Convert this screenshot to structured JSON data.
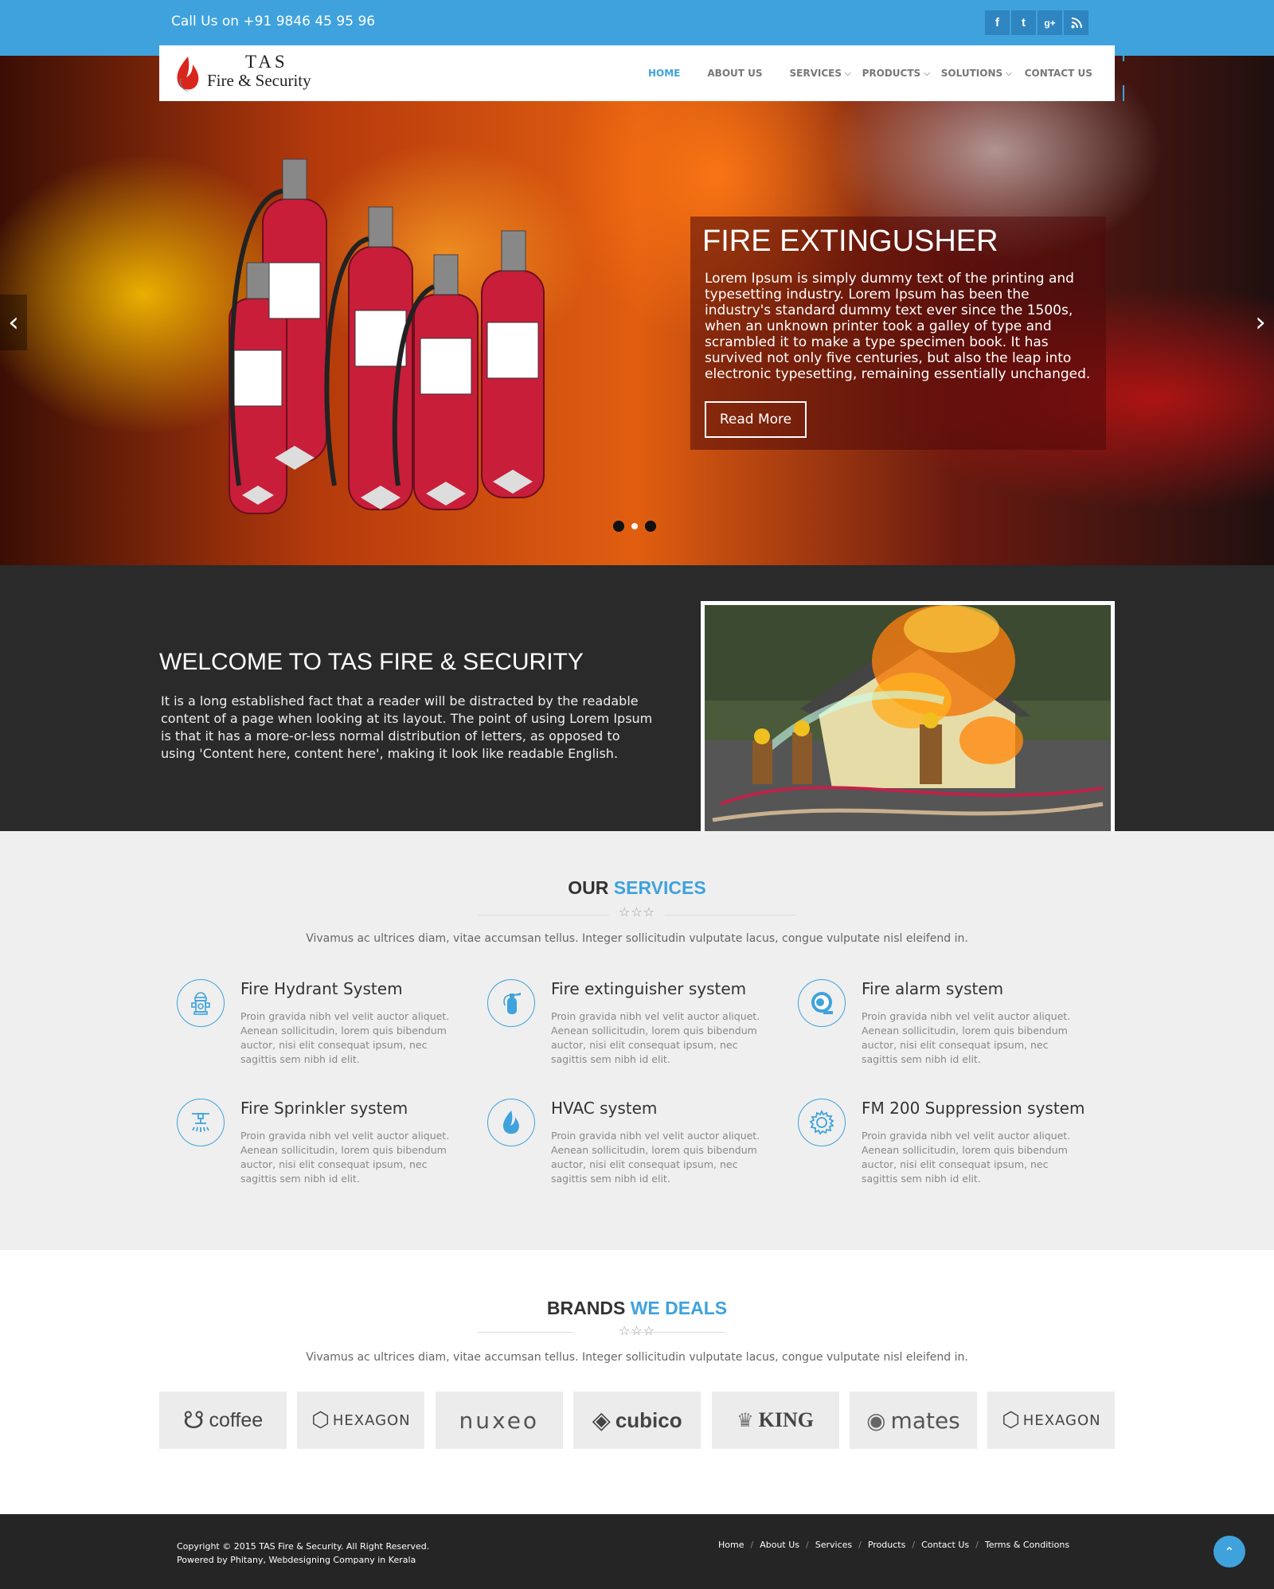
{
  "topbar": {
    "phone": "Call Us on +91 9846 45 95 96",
    "social": [
      {
        "icon": "facebook-icon",
        "glyph": "f"
      },
      {
        "icon": "twitter-icon",
        "glyph": "t"
      },
      {
        "icon": "google-plus-icon",
        "glyph": "g+"
      },
      {
        "icon": "rss-icon",
        "glyph": "rss"
      }
    ]
  },
  "logo": {
    "line1": "TAS",
    "line2": "Fire & Security"
  },
  "nav": {
    "items": [
      {
        "label": "HOME",
        "active": true
      },
      {
        "label": "ABOUT US"
      },
      {
        "label": "SERVICES",
        "dropdown": true
      },
      {
        "label": "PRODUCTS",
        "dropdown": true
      },
      {
        "label": "SOLUTIONS",
        "dropdown": true
      },
      {
        "label": "CONTACT US"
      }
    ]
  },
  "hero": {
    "title": "FIRE EXTINGUSHER",
    "text": "Lorem Ipsum is simply dummy text of the printing and typesetting industry. Lorem Ipsum has been the industry's standard dummy text ever since the 1500s, when an unknown printer took a galley of type and scrambled it to make a type specimen book. It has survived not only five centuries, but also the leap into electronic typesetting, remaining essentially unchanged.",
    "button": "Read More",
    "prev": "‹",
    "next": "›"
  },
  "welcome": {
    "title": "WELCOME TO TAS FIRE & SECURITY",
    "text": "It is a long established fact that a reader will be distracted by the readable content of a page when looking at its layout. The point of using Lorem Ipsum is that it has a more-or-less normal distribution of letters, as opposed to using 'Content here, content here', making it look like readable English."
  },
  "services": {
    "title_a": "OUR",
    "title_b": "SERVICES",
    "stars": "☆☆☆",
    "subtitle": "Vivamus ac ultrices diam, vitae accumsan tellus. Integer sollicitudin vulputate lacus, congue vulputate nisl eleifend in.",
    "items": [
      {
        "title": "Fire Hydrant System",
        "icon": "fire-hydrant-icon",
        "text": "Proin gravida nibh vel velit auctor aliquet. Aenean sollicitudin, lorem quis bibendum auctor, nisi elit consequat ipsum, nec sagittis sem nibh id elit."
      },
      {
        "title": "Fire extinguisher system",
        "icon": "fire-extinguisher-icon",
        "text": "Proin gravida nibh vel velit auctor aliquet. Aenean sollicitudin, lorem quis bibendum auctor, nisi elit consequat ipsum, nec sagittis sem nibh id elit."
      },
      {
        "title": "Fire alarm system",
        "icon": "fire-alarm-icon",
        "text": "Proin gravida nibh vel velit auctor aliquet. Aenean sollicitudin, lorem quis bibendum auctor, nisi elit consequat ipsum, nec sagittis sem nibh id elit."
      },
      {
        "title": "Fire Sprinkler system",
        "icon": "sprinkler-icon",
        "text": "Proin gravida nibh vel velit auctor aliquet. Aenean sollicitudin, lorem quis bibendum auctor, nisi elit consequat ipsum, nec sagittis sem nibh id elit."
      },
      {
        "title": "HVAC system",
        "icon": "flame-icon",
        "text": "Proin gravida nibh vel velit auctor aliquet. Aenean sollicitudin, lorem quis bibendum auctor, nisi elit consequat ipsum, nec sagittis sem nibh id elit."
      },
      {
        "title": "FM 200 Suppression system",
        "icon": "gear-icon",
        "text": "Proin gravida nibh vel velit auctor aliquet. Aenean sollicitudin, lorem quis bibendum auctor, nisi elit consequat ipsum, nec sagittis sem nibh id elit."
      }
    ]
  },
  "brands": {
    "title_a": "BRANDS",
    "title_b": "WE DEALS",
    "stars": "☆☆☆",
    "subtitle": "Vivamus ac ultrices diam, vitae accumsan tellus. Integer sollicitudin vulputate lacus, congue vulputate nisl eleifend in.",
    "items": [
      "coffee",
      "HEXAGON",
      "nuxeo",
      "cubico",
      "KING",
      "mates",
      "HEXAGON"
    ]
  },
  "footer": {
    "copyright": "Copyright © 2015 TAS Fire & Security. All Right Reserved.",
    "powered": "Powered by Phitany, Webdesigning Company in Kerala",
    "links": [
      "Home",
      "About Us",
      "Services",
      "Products",
      "Contact Us",
      "Terms & Conditions"
    ],
    "sep": "/",
    "totop": "⌃"
  },
  "colors": {
    "accent": "#3fa2dd",
    "dark": "#2a2a2a",
    "footer": "#252525",
    "light": "#efefef"
  }
}
